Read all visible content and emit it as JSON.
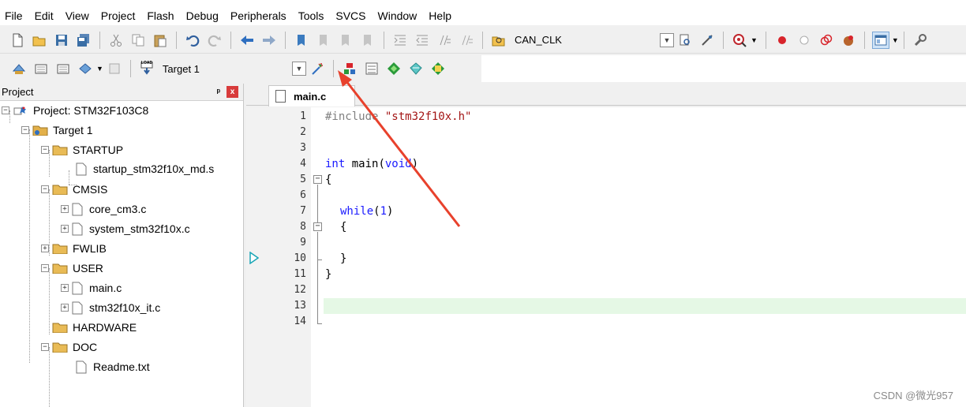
{
  "menu": [
    "File",
    "Edit",
    "View",
    "Project",
    "Flash",
    "Debug",
    "Peripherals",
    "Tools",
    "SVCS",
    "Window",
    "Help"
  ],
  "toolbar1": {
    "find_combo_value": "CAN_CLK",
    "icons": [
      "new-file-icon",
      "open-folder-icon",
      "save-icon",
      "save-all-icon",
      "cut-icon",
      "copy-icon",
      "paste-icon",
      "undo-icon",
      "redo-icon",
      "nav-back-icon",
      "nav-forward-icon",
      "bookmark-icon",
      "prev-bookmark-icon",
      "next-bookmark-icon",
      "clear-bookmarks-icon",
      "indent-icon",
      "unindent-icon",
      "comment-icon",
      "uncomment-icon",
      "find-in-files-icon",
      "find-icon",
      "incremental-find-icon",
      "debug-session-icon",
      "breakpoint-icon",
      "disable-breakpoint-icon",
      "kill-breakpoints-icon",
      "kill-all-icon",
      "window-layout-icon",
      "configure-icon"
    ]
  },
  "toolbar2": {
    "target_combo_value": "Target 1",
    "load_label": "LOAD",
    "icons": [
      "translate-icon",
      "build-icon",
      "rebuild-icon",
      "batch-build-icon",
      "stop-build-icon",
      "download-icon",
      "options-for-target-icon",
      "manage-project-items-icon",
      "select-packs-icon",
      "manage-runtime-icon",
      "pack-installer-icon",
      "event-recorder-icon"
    ]
  },
  "project_panel": {
    "title": "Project",
    "pin": "ᵖ",
    "close": "x",
    "tree": [
      {
        "label": "Project: STM32F103C8",
        "icon": "project-icon"
      },
      {
        "label": "Target 1",
        "icon": "target-folder-icon"
      },
      {
        "label": "STARTUP",
        "icon": "folder-icon"
      },
      {
        "label": "startup_stm32f10x_md.s",
        "icon": "file-icon"
      },
      {
        "label": "CMSIS",
        "icon": "folder-icon"
      },
      {
        "label": "core_cm3.c",
        "icon": "file-icon"
      },
      {
        "label": "system_stm32f10x.c",
        "icon": "file-icon"
      },
      {
        "label": "FWLIB",
        "icon": "folder-icon"
      },
      {
        "label": "USER",
        "icon": "folder-icon"
      },
      {
        "label": "main.c",
        "icon": "file-icon"
      },
      {
        "label": "stm32f10x_it.c",
        "icon": "file-icon"
      },
      {
        "label": "HARDWARE",
        "icon": "folder-icon"
      },
      {
        "label": "DOC",
        "icon": "folder-icon"
      },
      {
        "label": "Readme.txt",
        "icon": "file-icon"
      }
    ]
  },
  "editor": {
    "tab_label": "main.c",
    "line_numbers": [
      "1",
      "2",
      "3",
      "4",
      "5",
      "6",
      "7",
      "8",
      "9",
      "10",
      "11",
      "12",
      "13",
      "14"
    ],
    "code": {
      "l1_directive": "#include",
      "l1_string": "\"stm32f10x.h\"",
      "l4_type": "int",
      "l4_name": " main(",
      "l4_param": "void",
      "l4_close": ")",
      "l5": "{",
      "l7_kw": "while",
      "l7_open": "(",
      "l7_num": "1",
      "l7_close": ")",
      "l8": "{",
      "l10": "}",
      "l11": "}"
    },
    "current_line": "13"
  },
  "watermark": "CSDN @微光957",
  "colors": {
    "keyword": "#1a1aff",
    "preprocessor": "#808080",
    "string": "#a31515",
    "highlight_line": "#e5f8e5",
    "annotation_arrow": "#e8412c"
  }
}
